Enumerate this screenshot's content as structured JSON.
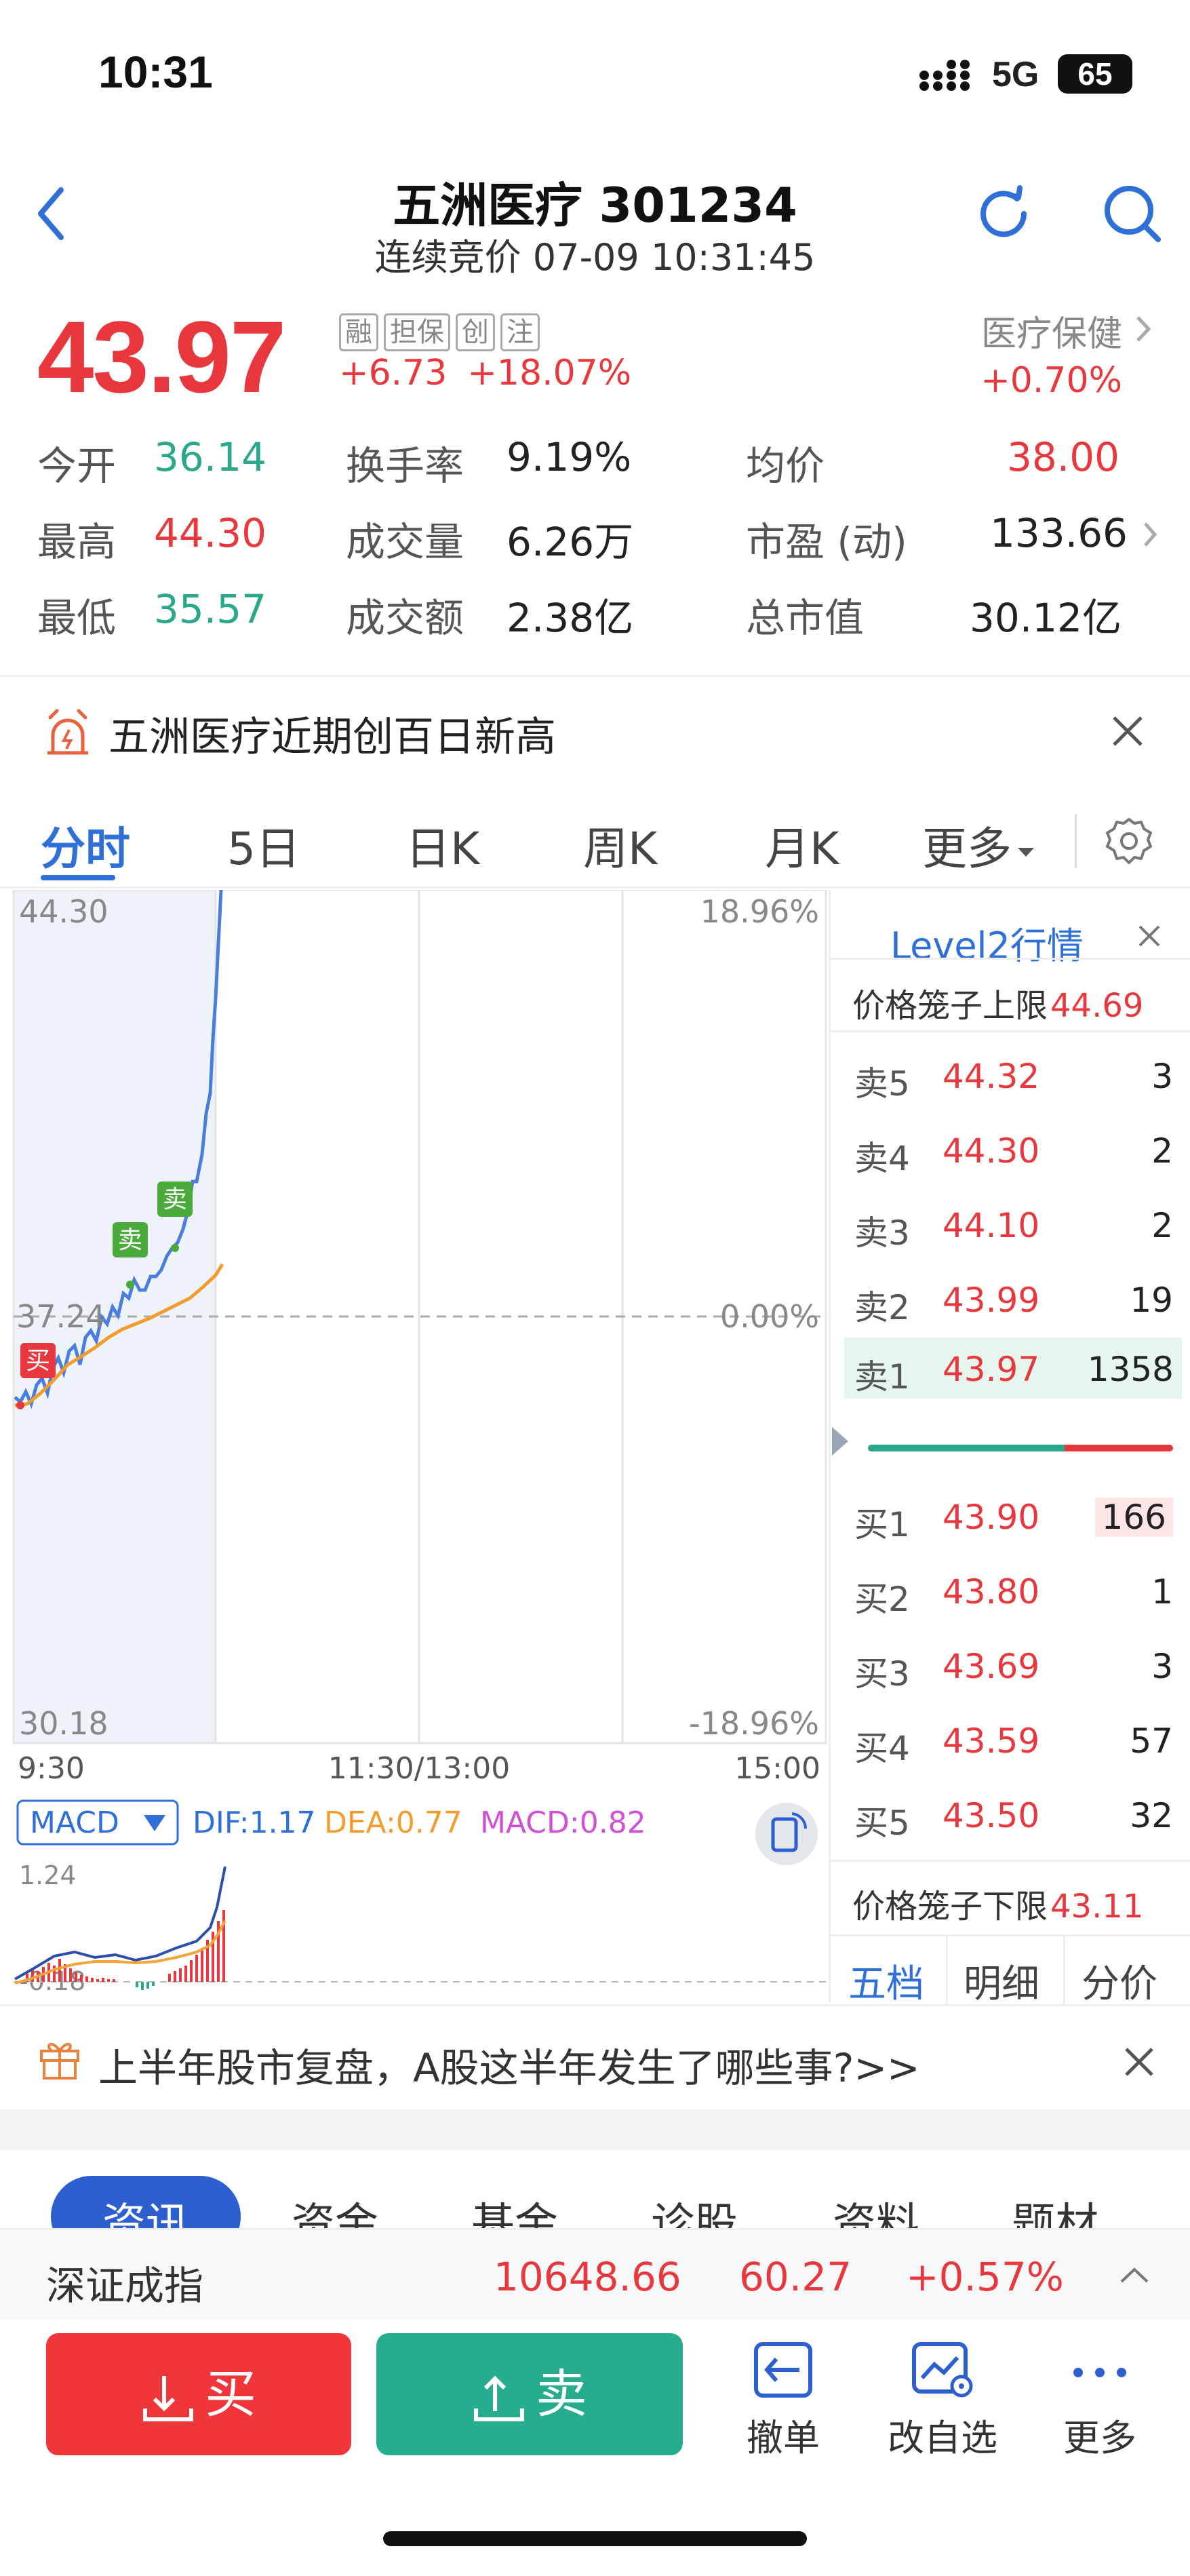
{
  "status_bar": {
    "time": "10:31",
    "network": "5G",
    "battery": "65"
  },
  "header": {
    "title": "五洲医疗 301234",
    "subtitle": "连续竞价 07-09 10:31:45"
  },
  "quote": {
    "price": "43.97",
    "tags": [
      "融",
      "担保",
      "创",
      "注"
    ],
    "change": "+6.73",
    "change_pct": "+18.07%",
    "sector_name": "医疗保健",
    "sector_pct": "+0.70%",
    "stats": [
      [
        {
          "label": "今开",
          "value": "36.14",
          "color": "green"
        },
        {
          "label": "换手率",
          "value": "9.19%"
        },
        {
          "label": "均价",
          "value": "38.00",
          "color": "red"
        }
      ],
      [
        {
          "label": "最高",
          "value": "44.30",
          "color": "red"
        },
        {
          "label": "成交量",
          "value": "6.26万"
        },
        {
          "label": "市盈 (动)",
          "value": "133.66"
        }
      ],
      [
        {
          "label": "最低",
          "value": "35.57",
          "color": "green"
        },
        {
          "label": "成交额",
          "value": "2.38亿"
        },
        {
          "label": "总市值",
          "value": "30.12亿"
        }
      ]
    ]
  },
  "notice": {
    "text": "五洲医疗近期创百日新高"
  },
  "tabs": [
    "分时",
    "5日",
    "日K",
    "周K",
    "月K",
    "更多"
  ],
  "chart": {
    "y_top": "44.30",
    "y_mid": "37.24",
    "y_bottom": "30.18",
    "pct_top": "18.96%",
    "pct_mid": "0.00%",
    "pct_bottom": "-18.96%",
    "x_labels": [
      "9:30",
      "11:30/13:00",
      "15:00"
    ],
    "markers": [
      "卖",
      "卖",
      "买"
    ],
    "macd": {
      "selector": "MACD",
      "dif": "DIF:1.17",
      "dea": "DEA:0.77",
      "macd": "MACD:0.82",
      "y_top": "1.24",
      "y_bottom": "-0.18"
    }
  },
  "level2": {
    "title": "Level2行情",
    "upper_limit_label": "价格笼子上限",
    "upper_limit": "44.69",
    "asks": [
      {
        "name": "卖5",
        "price": "44.32",
        "qty": "3"
      },
      {
        "name": "卖4",
        "price": "44.30",
        "qty": "2"
      },
      {
        "name": "卖3",
        "price": "44.10",
        "qty": "2"
      },
      {
        "name": "卖2",
        "price": "43.99",
        "qty": "19"
      },
      {
        "name": "卖1",
        "price": "43.97",
        "qty": "1358"
      }
    ],
    "bids": [
      {
        "name": "买1",
        "price": "43.90",
        "qty": "166"
      },
      {
        "name": "买2",
        "price": "43.80",
        "qty": "1"
      },
      {
        "name": "买3",
        "price": "43.69",
        "qty": "3"
      },
      {
        "name": "买4",
        "price": "43.59",
        "qty": "57"
      },
      {
        "name": "买5",
        "price": "43.50",
        "qty": "32"
      }
    ],
    "lower_limit_label": "价格笼子下限",
    "lower_limit": "43.11",
    "bottom_tabs": [
      "五档",
      "明细",
      "分价"
    ]
  },
  "promo": {
    "text": "上半年股市复盘，A股这半年发生了哪些事?>>"
  },
  "sub_tabs": [
    "资讯",
    "资金",
    "基金",
    "诊股",
    "资料",
    "题材"
  ],
  "index": {
    "name": "深证成指",
    "value": "10648.66",
    "change": "60.27",
    "pct": "+0.57%"
  },
  "bottom_bar": {
    "buy": "买",
    "sell": "卖",
    "cancel": "撤单",
    "watchlist": "改自选",
    "more": "更多"
  }
}
